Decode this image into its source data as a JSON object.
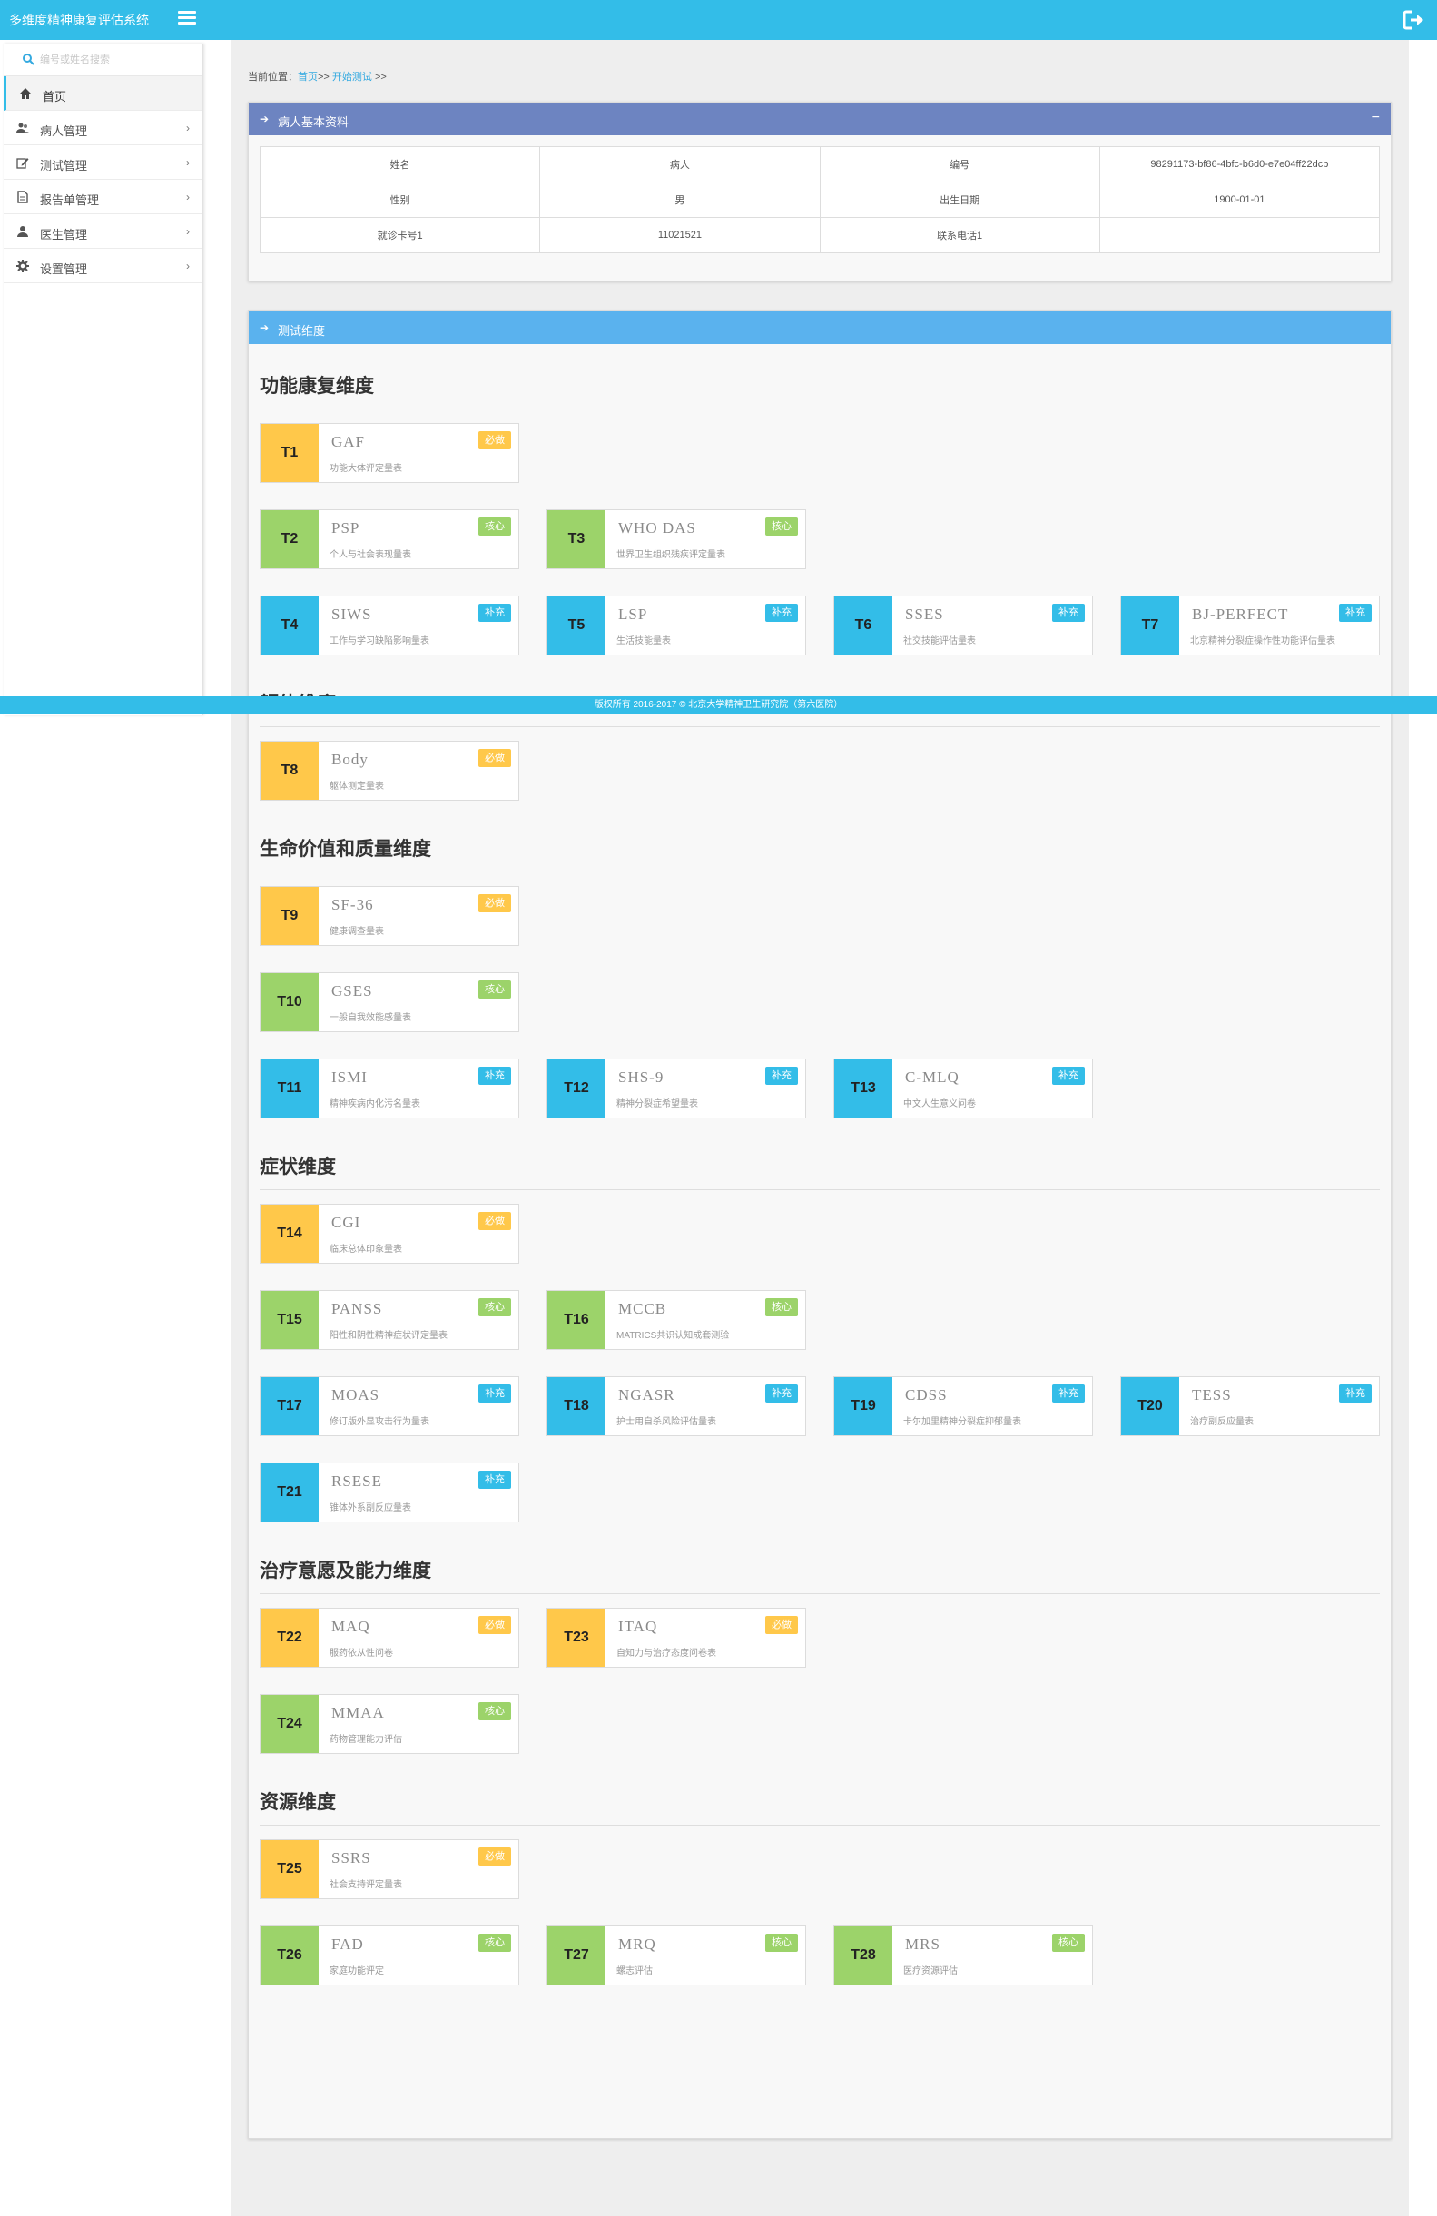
{
  "app": {
    "title": "多维度精神康复评估系统"
  },
  "sidebar": {
    "search_placeholder": "编号或姓名搜索",
    "items": [
      {
        "label": "首页",
        "icon": "home-icon",
        "active": true,
        "has_children": false
      },
      {
        "label": "病人管理",
        "icon": "users-icon",
        "active": false,
        "has_children": true
      },
      {
        "label": "测试管理",
        "icon": "edit-icon",
        "active": false,
        "has_children": true
      },
      {
        "label": "报告单管理",
        "icon": "file-icon",
        "active": false,
        "has_children": true
      },
      {
        "label": "医生管理",
        "icon": "doctor-icon",
        "active": false,
        "has_children": true
      },
      {
        "label": "设置管理",
        "icon": "gear-icon",
        "active": false,
        "has_children": true
      }
    ]
  },
  "breadcrumb": {
    "prefix": "当前位置：",
    "home": "首页",
    "sep1": ">>",
    "current": "开始测试",
    "sep2": ">>"
  },
  "patient_panel": {
    "title": "病人基本资料",
    "collapse_symbol": "−",
    "rows": [
      [
        "姓名",
        "病人",
        "编号",
        "98291173-bf86-4bfc-b6d0-e7e04ff22dcb"
      ],
      [
        "性别",
        "男",
        "出生日期",
        "1900-01-01"
      ],
      [
        "就诊卡号1",
        "11021521",
        "联系电话1",
        ""
      ]
    ]
  },
  "test_panel": {
    "title": "测试维度",
    "badges": {
      "required": "必做",
      "core": "核心",
      "supplement": "补充"
    },
    "sections": [
      {
        "title": "功能康复维度",
        "rows": [
          [
            {
              "code": "T1",
              "name": "GAF",
              "desc": "功能大体评定量表",
              "type": "required"
            }
          ],
          [
            {
              "code": "T2",
              "name": "PSP",
              "desc": "个人与社会表现量表",
              "type": "core"
            },
            {
              "code": "T3",
              "name": "WHO DAS",
              "desc": "世界卫生组织残疾评定量表",
              "type": "core"
            }
          ],
          [
            {
              "code": "T4",
              "name": "SIWS",
              "desc": "工作与学习缺陷影响量表",
              "type": "supplement"
            },
            {
              "code": "T5",
              "name": "LSP",
              "desc": "生活技能量表",
              "type": "supplement"
            },
            {
              "code": "T6",
              "name": "SSES",
              "desc": "社交技能评估量表",
              "type": "supplement"
            },
            {
              "code": "T7",
              "name": "BJ-PERFECT",
              "desc": "北京精神分裂症操作性功能评估量表",
              "type": "supplement"
            }
          ]
        ]
      },
      {
        "title": "躯体维度",
        "rows": [
          [
            {
              "code": "T8",
              "name": "Body",
              "desc": "躯体测定量表",
              "type": "required"
            }
          ]
        ]
      },
      {
        "title": "生命价值和质量维度",
        "rows": [
          [
            {
              "code": "T9",
              "name": "SF-36",
              "desc": "健康调查量表",
              "type": "required"
            }
          ],
          [
            {
              "code": "T10",
              "name": "GSES",
              "desc": "一般自我效能感量表",
              "type": "core"
            }
          ],
          [
            {
              "code": "T11",
              "name": "ISMI",
              "desc": "精神疾病内化污名量表",
              "type": "supplement"
            },
            {
              "code": "T12",
              "name": "SHS-9",
              "desc": "精神分裂症希望量表",
              "type": "supplement"
            },
            {
              "code": "T13",
              "name": "C-MLQ",
              "desc": "中文人生意义问卷",
              "type": "supplement"
            }
          ]
        ]
      },
      {
        "title": "症状维度",
        "rows": [
          [
            {
              "code": "T14",
              "name": "CGI",
              "desc": "临床总体印象量表",
              "type": "required"
            }
          ],
          [
            {
              "code": "T15",
              "name": "PANSS",
              "desc": "阳性和阴性精神症状评定量表",
              "type": "core"
            },
            {
              "code": "T16",
              "name": "MCCB",
              "desc": "MATRICS共识认知成套测验",
              "type": "core"
            }
          ],
          [
            {
              "code": "T17",
              "name": "MOAS",
              "desc": "修订版外显攻击行为量表",
              "type": "supplement"
            },
            {
              "code": "T18",
              "name": "NGASR",
              "desc": "护士用自杀风险评估量表",
              "type": "supplement"
            },
            {
              "code": "T19",
              "name": "CDSS",
              "desc": "卡尔加里精神分裂症抑郁量表",
              "type": "supplement"
            },
            {
              "code": "T20",
              "name": "TESS",
              "desc": "治疗副反应量表",
              "type": "supplement"
            }
          ],
          [
            {
              "code": "T21",
              "name": "RSESE",
              "desc": "锥体外系副反应量表",
              "type": "supplement"
            }
          ]
        ]
      },
      {
        "title": "治疗意愿及能力维度",
        "rows": [
          [
            {
              "code": "T22",
              "name": "MAQ",
              "desc": "服药依从性问卷",
              "type": "required"
            },
            {
              "code": "T23",
              "name": "ITAQ",
              "desc": "自知力与治疗态度问卷表",
              "type": "required"
            }
          ],
          [
            {
              "code": "T24",
              "name": "MMAA",
              "desc": "药物管理能力评估",
              "type": "core"
            }
          ]
        ]
      },
      {
        "title": "资源维度",
        "rows": [
          [
            {
              "code": "T25",
              "name": "SSRS",
              "desc": "社会支持评定量表",
              "type": "required"
            }
          ],
          [
            {
              "code": "T26",
              "name": "FAD",
              "desc": "家庭功能评定",
              "type": "core"
            },
            {
              "code": "T27",
              "name": "MRQ",
              "desc": "螺志评估",
              "type": "core"
            },
            {
              "code": "T28",
              "name": "MRS",
              "desc": "医疗资源评估",
              "type": "core"
            }
          ]
        ]
      }
    ]
  },
  "footer": {
    "text": "版权所有 2016-2017 © 北京大学精神卫生研究院（第六医院）"
  },
  "colors": {
    "topbar": "#33bde8",
    "patient_header": "#6d84c1",
    "test_header": "#5ab2ee",
    "required": "#ffc84a",
    "core": "#9cd36a",
    "supplement": "#33bde8"
  }
}
